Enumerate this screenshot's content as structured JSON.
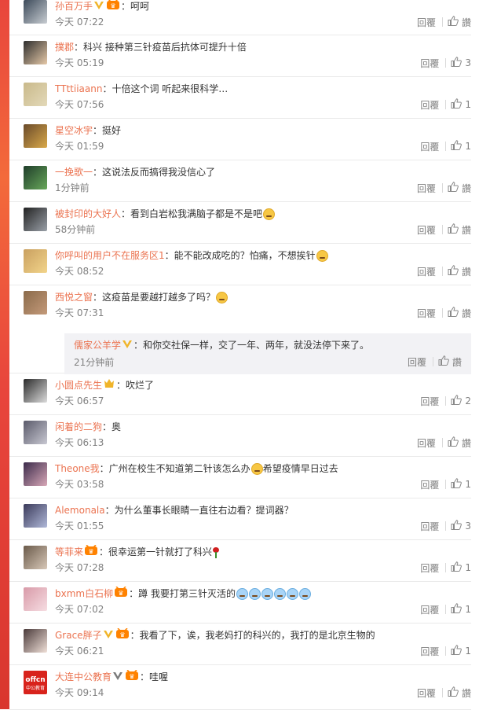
{
  "actions": {
    "reply_label": "回覆",
    "like_icon": "thumbs-up-icon"
  },
  "comments": [
    {
      "user": "孙百万手",
      "text": "呵呵",
      "time": "今天 07:22",
      "likes": "讚",
      "badges": [
        "v-gold",
        "vip"
      ],
      "avatar": [
        "#3c4a5a",
        "#c8cdd2"
      ]
    },
    {
      "user": "撲郡",
      "text": "科兴 接种第三针疫苗后抗体可提升十倍",
      "time": "今天 05:19",
      "likes": "3",
      "badges": [],
      "avatar": [
        "#2d2d2d",
        "#e6c9a8"
      ]
    },
    {
      "user": "TTttiiaann",
      "text": "十倍这个词 听起来很科学…",
      "time": "今天 07:56",
      "likes": "1",
      "badges": [],
      "avatar": [
        "#c9b98a",
        "#e3d9b9"
      ]
    },
    {
      "user": "星空冰宇",
      "text": "挺好",
      "time": "今天 01:59",
      "likes": "1",
      "badges": [],
      "avatar": [
        "#6a4a2a",
        "#d9a94a"
      ]
    },
    {
      "user": "一挽歌一",
      "text": "这说法反而搞得我没信心了",
      "time": "1分钟前",
      "likes": "讚",
      "badges": [],
      "avatar": [
        "#1f3d2a",
        "#68a85a"
      ]
    },
    {
      "user": "被封印的大好人",
      "text": "看到白岩松我满脑子都是不是吧",
      "time": "58分钟前",
      "likes": "讚",
      "badges": [],
      "emoji": [
        "yellow"
      ],
      "avatar": [
        "#222222",
        "#9aa0a8"
      ]
    },
    {
      "user": "你呼叫的用户不在服务区1",
      "text": "能不能改成吃的？怕痛，不想挨针",
      "time": "今天 08:52",
      "likes": "讚",
      "badges": [],
      "emoji": [
        "yellow"
      ],
      "avatar": [
        "#c9a060",
        "#f2d48a"
      ]
    },
    {
      "user": "西悦之窗",
      "text": "这疫苗是要越打越多了吗？",
      "time": "今天 07:31",
      "likes": "讚",
      "badges": [],
      "emoji": [
        "yellow"
      ],
      "avatar": [
        "#8a6a4a",
        "#c49a7a"
      ]
    },
    {
      "user": "小圆点先生",
      "text": "吹烂了",
      "time": "今天 06:57",
      "likes": "2",
      "badges": [
        "vip-gold"
      ],
      "avatar": [
        "#2a2a2a",
        "#dcdcdc"
      ]
    },
    {
      "user": "闲着的二狗",
      "text": "奥",
      "time": "今天 06:13",
      "likes": "讚",
      "badges": [],
      "avatar": [
        "#5a5a6a",
        "#c8c8d2"
      ]
    },
    {
      "user": "Theone我",
      "text": "广州在校生不知道第二针该怎么办",
      "text2": "希望疫情早日过去",
      "time": "今天 03:58",
      "likes": "1",
      "badges": [],
      "emoji": [
        "yellow"
      ],
      "avatar": [
        "#3a2a4a",
        "#d8a8b8"
      ]
    },
    {
      "user": "Alemonala",
      "text": "为什么董事长眼睛一直往右边看？提词器？",
      "time": "今天 01:55",
      "likes": "3",
      "badges": [],
      "avatar": [
        "#3a3a5a",
        "#b0b8d8"
      ]
    },
    {
      "user": "等菲来",
      "text": "很幸运第一针就打了科兴",
      "time": "今天 07:28",
      "likes": "1",
      "badges": [
        "vip"
      ],
      "rose": true,
      "avatar": [
        "#6a5a4a",
        "#d8c8b8"
      ]
    },
    {
      "user": "bxmm白石柳",
      "text": "蹲 我要打第三针灭活的",
      "time": "今天 07:02",
      "likes": "1",
      "badges": [
        "vip"
      ],
      "emoji": [
        "blue",
        "blue",
        "blue",
        "blue",
        "blue",
        "blue"
      ],
      "avatar": [
        "#d89aa8",
        "#f6dde2"
      ]
    },
    {
      "user": "Grace胖子",
      "text": "我看了下，诶，我老妈打的科兴的，我打的是北京生物的",
      "time": "今天 06:21",
      "likes": "1",
      "badges": [
        "v-gold",
        "vip"
      ],
      "avatar": [
        "#4a3a3a",
        "#f0e0d8"
      ]
    },
    {
      "user": "大连中公教育",
      "text": "哇喔",
      "time": "今天 09:14",
      "likes": "讚",
      "badges": [
        "v-gray",
        "vip"
      ],
      "avatar": [
        "#d8231c",
        "#ffffff"
      ],
      "avatar_text": "offcn\n中公教育"
    }
  ],
  "sub_reply": {
    "user": "儒家公羊学",
    "text": "和你交社保一样，交了一年、两年，就没法停下来了。",
    "time": "21分钟前",
    "likes": "讚",
    "badges": [
      "v-gold"
    ]
  },
  "colors": {
    "username": "#eb7350",
    "sidebar": "#e8453c",
    "meta": "#808080"
  }
}
